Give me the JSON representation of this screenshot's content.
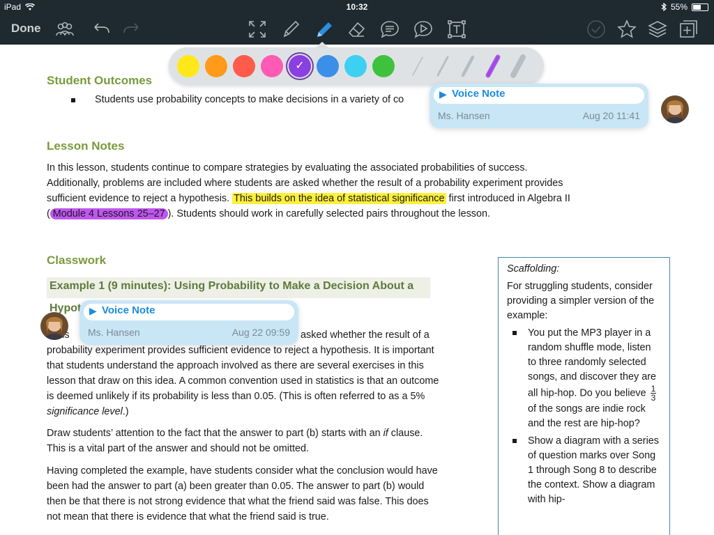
{
  "status_bar": {
    "device": "iPad",
    "time": "10:32",
    "battery": "55%",
    "battery_level": 0.55
  },
  "toolbar": {
    "done_label": "Done",
    "tools": [
      "users-icon",
      "undo-icon",
      "redo-icon",
      "expand-icon",
      "pencil-icon",
      "marker-icon",
      "eraser-icon",
      "comment-icon",
      "voice-comment-icon",
      "text-box-icon",
      "check-icon",
      "star-icon",
      "layers-icon",
      "add-page-icon"
    ],
    "active_tool": "marker-icon"
  },
  "palette": {
    "colors": [
      "#ffe81a",
      "#ff9a1a",
      "#ff5a4a",
      "#ff5ab4",
      "#8a3fe0",
      "#3b8fe8",
      "#3ed0f0",
      "#3ec23e"
    ],
    "selected_color": "#8a3fe0",
    "stroke_color": "#b7bdc1",
    "selected_stroke_color": "#b55cf0"
  },
  "doc": {
    "student_outcomes_heading": "Student Outcomes",
    "student_outcomes_bullet": "Students use probability concepts to make decisions in a variety of co",
    "lesson_notes_heading": "Lesson Notes",
    "lesson_notes_line1": "In this lesson, students continue to compare strategies by evaluating the associated probabilities of success.",
    "lesson_notes_line2": "Additionally, problems are included where students are asked whether the result of a probability experiment provides",
    "lesson_notes_line3_before": "sufficient evidence to reject a hypothesis.  ",
    "lesson_notes_line3_highlight": "This builds on the idea of statistical significance",
    "lesson_notes_line3_after": " first introduced in Algebra II",
    "lesson_notes_line4_paren_open": "(",
    "lesson_notes_line4_highlight": "Module 4 Lessons 25–27",
    "lesson_notes_line4_after": ").  Students should work in carefully selected pairs throughout the lesson.",
    "classwork_heading": "Classwork",
    "example_title_line1": "Example 1  (9 minutes):  Using Probability to Make a Decision About a",
    "example_title_line2": "Hypot",
    "example_para_line1_start": "s is",
    "example_para_line1_end": "asked whether the result of a",
    "example_para_rest": [
      "probability experiment provides sufficient evidence to reject a hypothesis.  It is important",
      "that students understand the approach involved as there are several exercises in this",
      "lesson that draw on this idea.  A common convention used in statistics is that an outcome",
      "is deemed unlikely if its probability is less than 0.05.  (This is often referred to as a 5%"
    ],
    "example_para_last_italic": "significance level",
    "example_para_last_after": ".)",
    "draw_para": [
      "Draw students’ attention to the fact that the answer to part (b) starts with an ",
      "if",
      " clause.",
      "This is a vital part of the answer and should not be omitted."
    ],
    "having_para": [
      "Having completed the example, have students consider what the conclusion would have",
      "been had the answer to part (a) been greater than 0.05.  The answer to part (b) would",
      "then be that there is not strong evidence that what the friend said was false.  This does",
      "not mean that there is evidence that what the friend said is true."
    ]
  },
  "scaffolding": {
    "title": "Scaffolding:",
    "intro": "For struggling students, consider providing a simpler version of the example:",
    "item1_before": "You put the MP3 player in a random shuffle mode, listen to three randomly selected songs, and discover they are all hip-hop.  Do you believe ",
    "item1_frac_num": "1",
    "item1_frac_den": "3",
    "item1_after": " of the songs are indie rock and the rest are hip-hop?",
    "item2": "Show a diagram with a series of question marks over Song 1 through Song 8 to describe the context. Show a diagram with hip-"
  },
  "voice_notes": [
    {
      "label": "Voice Note",
      "play": "▶",
      "author": "Ms. Hansen",
      "date": "Aug 20 11:41"
    },
    {
      "label": "Voice Note",
      "play": "▶",
      "author": "Ms. Hansen",
      "date": "Aug 22 09:59"
    }
  ]
}
